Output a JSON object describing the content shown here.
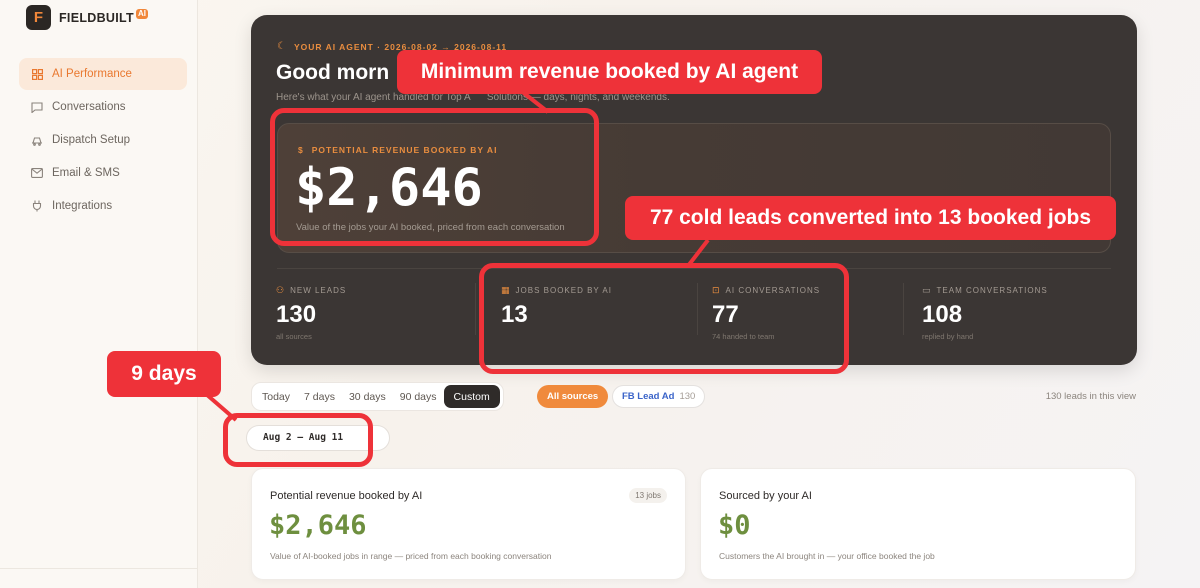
{
  "brand": {
    "name": "FIELDBUILT",
    "badge": "AI"
  },
  "sidebar": {
    "items": [
      {
        "label": "AI Performance",
        "icon": "grid-icon",
        "active": true
      },
      {
        "label": "Conversations",
        "icon": "chat-icon",
        "active": false
      },
      {
        "label": "Dispatch Setup",
        "icon": "truck-icon",
        "active": false
      },
      {
        "label": "Email & SMS",
        "icon": "mail-icon",
        "active": false
      },
      {
        "label": "Integrations",
        "icon": "plug-icon",
        "active": false
      }
    ]
  },
  "hero": {
    "eyebrow": "YOUR AI AGENT · 2026-08-02 → 2026-08-11",
    "greeting": "Good morn",
    "subtitle": "Here's what your AI agent handled for Top A",
    "subtitle_tail": "Solutions — days, nights, and weekends.",
    "revenue_label": "POTENTIAL REVENUE BOOKED BY AI",
    "revenue_value": "$2,646",
    "revenue_caption": "Value of the jobs your AI booked, priced from each conversation",
    "stats": [
      {
        "label": "NEW LEADS",
        "value": "130",
        "sub": "all sources",
        "icon": "user-plus-icon"
      },
      {
        "label": "JOBS BOOKED BY AI",
        "value": "13",
        "sub": "",
        "icon": "calendar-icon"
      },
      {
        "label": "AI CONVERSATIONS",
        "value": "77",
        "sub": "74 handed to team",
        "icon": "bot-icon"
      },
      {
        "label": "TEAM CONVERSATIONS",
        "value": "108",
        "sub": "replied by hand",
        "icon": "chat-icon"
      }
    ]
  },
  "filters": {
    "ranges": [
      "Today",
      "7 days",
      "30 days",
      "90 days",
      "Custom"
    ],
    "active_range": "Custom",
    "sources_chip": "All sources",
    "source_fb": "FB Lead Ad",
    "source_fb_count": "130",
    "leads_in_view": "130 leads in this view",
    "date_range": "Aug 2 – Aug 11"
  },
  "cards": [
    {
      "title": "Potential revenue booked by AI",
      "value": "$2,646",
      "caption": "Value of AI-booked jobs in range — priced from each booking conversation",
      "badge": "13 jobs"
    },
    {
      "title": "Sourced by your AI",
      "value": "$0",
      "caption": "Customers the AI brought in — your office booked the job",
      "badge": ""
    }
  ],
  "annotations": {
    "revenue": "Minimum revenue booked by AI agent",
    "leads": "77 cold leads converted into 13 booked jobs",
    "days": "9 days"
  },
  "colors": {
    "accent": "#f08a3c",
    "annotation": "#ee3239",
    "hero_bg": "#3b3634",
    "money_green": "#6e8f3f"
  }
}
